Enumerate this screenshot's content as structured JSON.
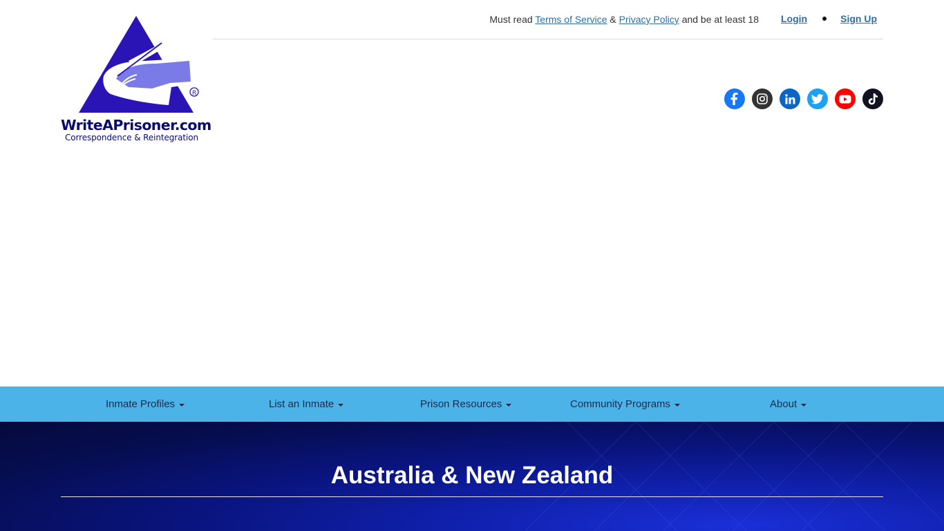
{
  "logo": {
    "title": "WriteAPrisoner.com",
    "subtitle": "Correspondence & Reintegration",
    "registered": "®"
  },
  "notice": {
    "prefix": "Must read",
    "terms_link": "Terms of Service",
    "amp": "&",
    "privacy_link": "Privacy Policy",
    "suffix": "and be at least 18"
  },
  "auth": {
    "login": "Login",
    "signup": "Sign Up"
  },
  "social": [
    {
      "name": "facebook-icon",
      "color": "#1877f2"
    },
    {
      "name": "instagram-icon",
      "color": "#333333"
    },
    {
      "name": "linkedin-icon",
      "color": "#0a66c2"
    },
    {
      "name": "twitter-icon",
      "color": "#1da1f2"
    },
    {
      "name": "youtube-icon",
      "color": "#ff0000"
    },
    {
      "name": "tiktok-icon",
      "color": "#111122"
    }
  ],
  "nav": {
    "items": [
      {
        "label": "Inmate Profiles"
      },
      {
        "label": "List an Inmate"
      },
      {
        "label": "Prison Resources"
      },
      {
        "label": "Community Programs"
      },
      {
        "label": "About"
      }
    ]
  },
  "hero": {
    "title": "Australia & New Zealand"
  },
  "colors": {
    "nav_bg": "#4cb3e8",
    "link": "#2e6da4",
    "logo_blue": "#2b14b5"
  }
}
